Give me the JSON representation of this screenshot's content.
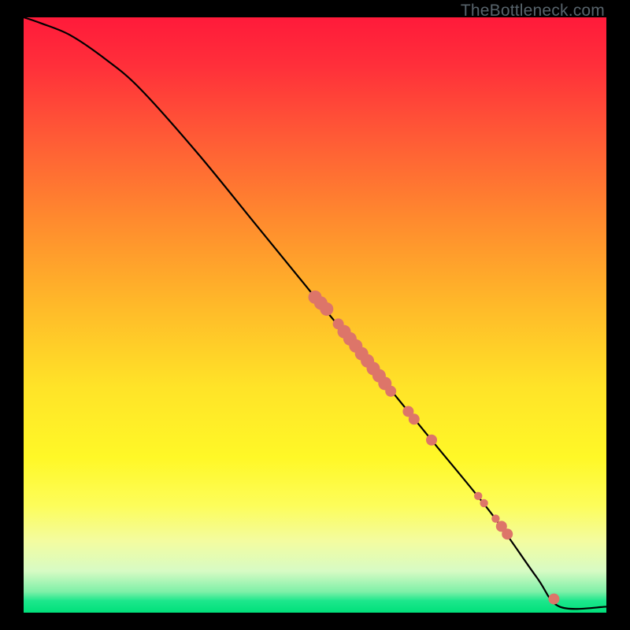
{
  "watermark": "TheBottleneck.com",
  "colors": {
    "dot": "#dd7569",
    "line": "#000000"
  },
  "chart_data": {
    "type": "line",
    "title": "",
    "xlabel": "",
    "ylabel": "",
    "xlim": [
      0,
      100
    ],
    "ylim": [
      0,
      100
    ],
    "grid": false,
    "legend": null,
    "series": [
      {
        "name": "curve",
        "x": [
          0,
          3,
          8,
          14,
          20,
          30,
          40,
          50,
          60,
          70,
          80,
          88,
          92,
          100
        ],
        "y": [
          100,
          99,
          97,
          93,
          88,
          77,
          65,
          53,
          41,
          29,
          17,
          6,
          1,
          1
        ]
      }
    ],
    "points": [
      {
        "x": 50,
        "y": 53,
        "size": "big"
      },
      {
        "x": 51,
        "y": 52,
        "size": "big"
      },
      {
        "x": 52,
        "y": 51,
        "size": "big"
      },
      {
        "x": 54,
        "y": 48.5,
        "size": "med"
      },
      {
        "x": 55,
        "y": 47.2,
        "size": "big"
      },
      {
        "x": 56,
        "y": 46,
        "size": "big"
      },
      {
        "x": 57,
        "y": 44.8,
        "size": "big"
      },
      {
        "x": 58,
        "y": 43.5,
        "size": "big"
      },
      {
        "x": 59,
        "y": 42.3,
        "size": "big"
      },
      {
        "x": 60,
        "y": 41,
        "size": "big"
      },
      {
        "x": 61,
        "y": 39.8,
        "size": "big"
      },
      {
        "x": 62,
        "y": 38.5,
        "size": "big"
      },
      {
        "x": 63,
        "y": 37.2,
        "size": "med"
      },
      {
        "x": 66,
        "y": 33.8,
        "size": "med"
      },
      {
        "x": 67,
        "y": 32.5,
        "size": "med"
      },
      {
        "x": 70,
        "y": 29,
        "size": "med"
      },
      {
        "x": 78,
        "y": 19.6,
        "size": "sm"
      },
      {
        "x": 79,
        "y": 18.4,
        "size": "sm"
      },
      {
        "x": 81,
        "y": 15.8,
        "size": "sm"
      },
      {
        "x": 82,
        "y": 14.5,
        "size": "med"
      },
      {
        "x": 83,
        "y": 13.2,
        "size": "med"
      },
      {
        "x": 91,
        "y": 2.3,
        "size": "med"
      }
    ]
  }
}
